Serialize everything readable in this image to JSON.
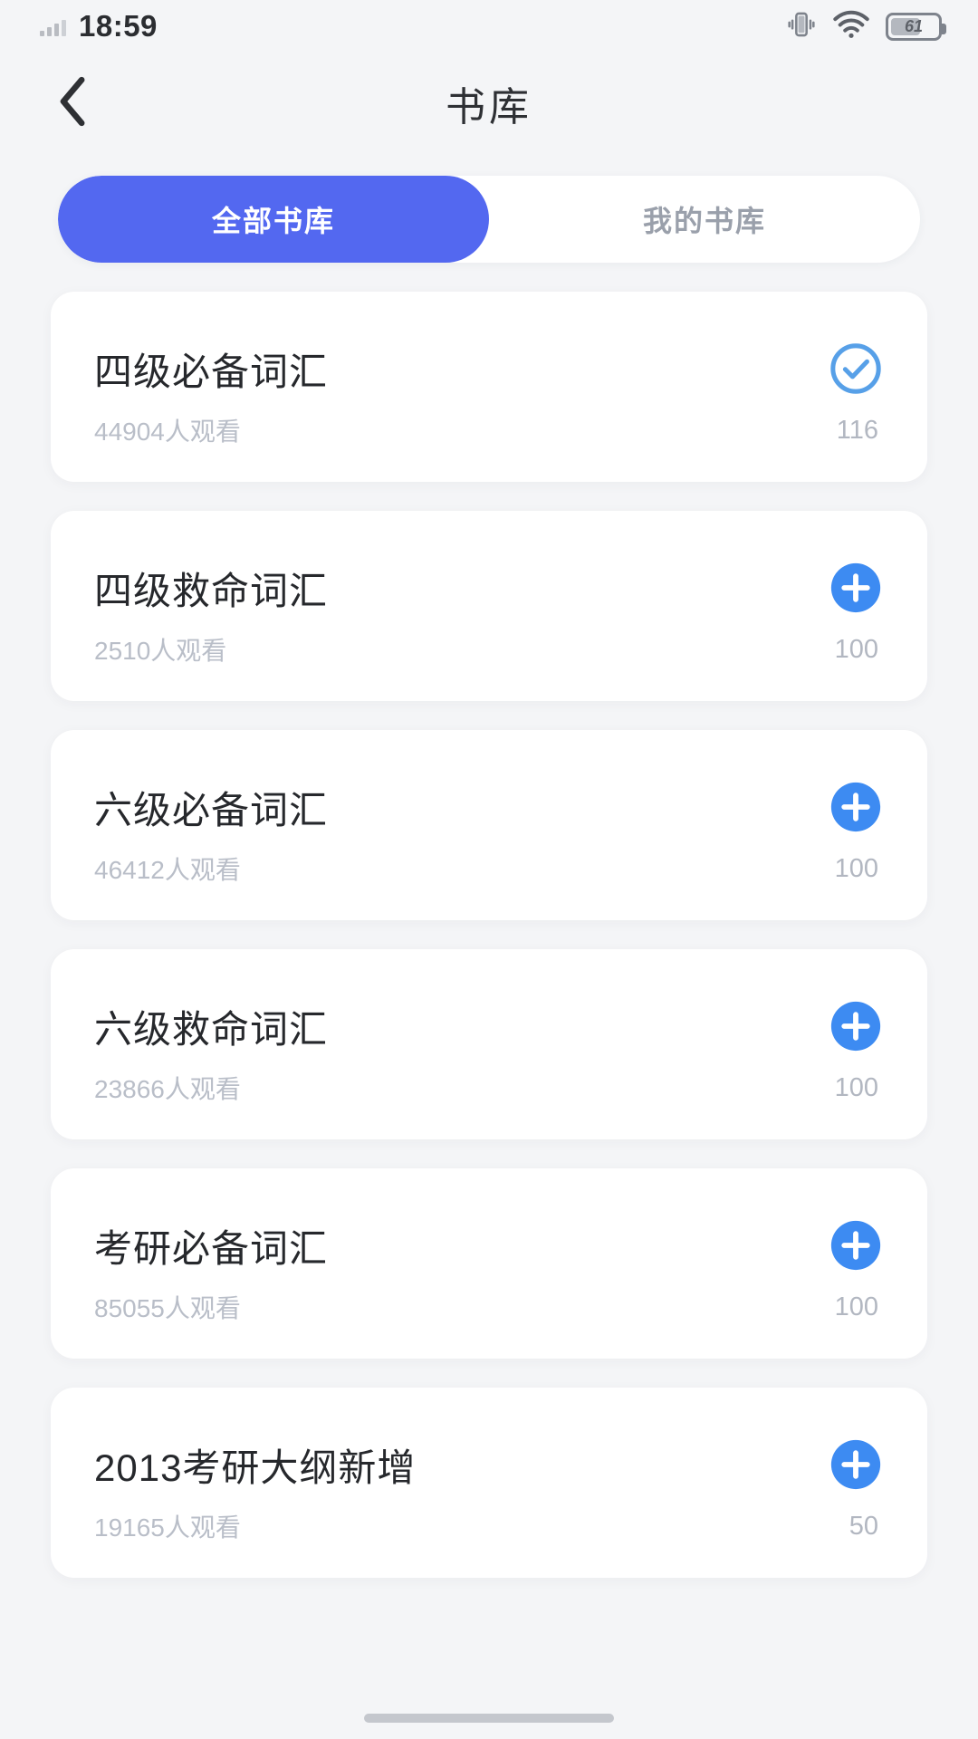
{
  "status_bar": {
    "time": "18:59",
    "battery_level": "61",
    "signal_icon": "signal-bars-icon",
    "vibrate_icon": "vibrate-icon",
    "wifi_icon": "wifi-icon",
    "battery_icon": "battery-icon"
  },
  "header": {
    "back_icon": "back-chevron-icon",
    "title": "书库"
  },
  "tabs": [
    {
      "label": "全部书库",
      "active": true
    },
    {
      "label": "我的书库",
      "active": false
    }
  ],
  "colors": {
    "accent_tab": "#5368f0",
    "accent_action": "#3d8bf2",
    "check_blue": "#57a0e8",
    "page_bg": "#f4f5f7",
    "card_bg": "#ffffff",
    "title_text": "#26282c",
    "muted_text": "#b9bec8"
  },
  "books": [
    {
      "title": "四级必备词汇",
      "views": "44904人观看",
      "count": "116",
      "action": "check-circle-icon"
    },
    {
      "title": "四级救命词汇",
      "views": "2510人观看",
      "count": "100",
      "action": "add-circle-icon"
    },
    {
      "title": "六级必备词汇",
      "views": "46412人观看",
      "count": "100",
      "action": "add-circle-icon"
    },
    {
      "title": "六级救命词汇",
      "views": "23866人观看",
      "count": "100",
      "action": "add-circle-icon"
    },
    {
      "title": "考研必备词汇",
      "views": "85055人观看",
      "count": "100",
      "action": "add-circle-icon"
    },
    {
      "title": "2013考研大纲新增",
      "views": "19165人观看",
      "count": "50",
      "action": "add-circle-icon"
    }
  ]
}
